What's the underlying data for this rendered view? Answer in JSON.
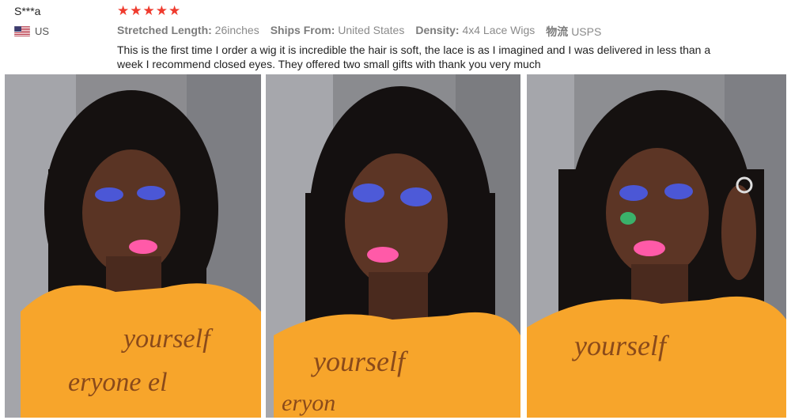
{
  "reviewer": {
    "name": "S***a",
    "country": "US",
    "flag_icon": "us-flag-icon"
  },
  "rating": {
    "stars": 5,
    "max": 5,
    "star_color": "#ef3b2e"
  },
  "attributes": [
    {
      "label": "Stretched Length:",
      "value": "26inches"
    },
    {
      "label": "Ships From:",
      "value": "United States"
    },
    {
      "label": "Density:",
      "value": "4x4 Lace Wigs"
    },
    {
      "label": "物流",
      "value": "USPS"
    }
  ],
  "review_text": "This is the first time I order a wig it is incredible the hair is soft, the lace is as I imagined and I was delivered in less than a week I recommend closed eyes. They offered two small gifts with thank you very much",
  "photos": [
    {
      "shirt_text": [
        "yourself",
        "eryone el"
      ]
    },
    {
      "shirt_text": [
        "yourself",
        "eryon"
      ]
    },
    {
      "shirt_text": [
        "yourself",
        ""
      ]
    }
  ]
}
